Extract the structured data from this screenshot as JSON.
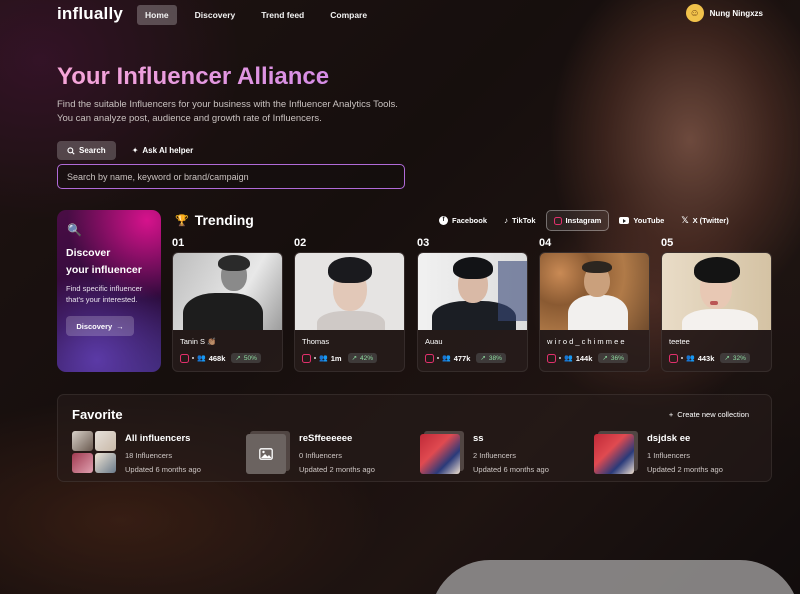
{
  "nav": {
    "logo": "influally",
    "links": [
      "Home",
      "Discovery",
      "Trend feed",
      "Compare"
    ],
    "active": "Home",
    "user_name": "Nung Ningxzs"
  },
  "hero": {
    "title": "Your Influencer Alliance",
    "description": "Find the suitable Influencers for your business with the Influencer Analytics Tools. You can analyze post, audience and growth rate of Influencers.",
    "tabs": [
      {
        "label": "Search",
        "icon": "search-icon",
        "active": true
      },
      {
        "label": "Ask AI helper",
        "icon": "sparkle-icon",
        "active": false
      }
    ],
    "search_placeholder": "Search by name, keyword or brand/campaign"
  },
  "discover": {
    "icon": "magnifier-icon",
    "title_line1": "Discover",
    "title_line2": "your influencer",
    "description": "Find specific influencer that's your interested.",
    "button_label": "Discovery",
    "button_icon": "arrow-right-icon"
  },
  "trending": {
    "title": "Trending",
    "icon": "trophy-icon",
    "platforms": [
      {
        "label": "Facebook",
        "icon": "facebook-icon",
        "active": false
      },
      {
        "label": "TikTok",
        "icon": "tiktok-icon",
        "active": false
      },
      {
        "label": "Instagram",
        "icon": "instagram-icon",
        "active": true
      },
      {
        "label": "YouTube",
        "icon": "youtube-icon",
        "active": false
      },
      {
        "label": "X (Twitter)",
        "icon": "x-icon",
        "active": false
      }
    ],
    "cards": [
      {
        "rank": "01",
        "name": "Tanin S 👏🏽",
        "followers": "468k",
        "growth": "50%"
      },
      {
        "rank": "02",
        "name": "Thomas",
        "followers": "1m",
        "growth": "42%"
      },
      {
        "rank": "03",
        "name": "Auau",
        "followers": "477k",
        "growth": "38%"
      },
      {
        "rank": "04",
        "name": "w i r o d _ c h i m m e e",
        "followers": "144k",
        "growth": "36%"
      },
      {
        "rank": "05",
        "name": "teetee",
        "followers": "443k",
        "growth": "32%"
      }
    ]
  },
  "favorite": {
    "title": "Favorite",
    "create_label": "Create new collection",
    "collections": [
      {
        "name": "All influencers",
        "count": "18 Influencers",
        "updated": "Updated 6 months ago"
      },
      {
        "name": "reSffeeeeee",
        "count": "0 Influencers",
        "updated": "Updated 2 months ago"
      },
      {
        "name": "ss",
        "count": "2 Influencers",
        "updated": "Updated 6 months ago"
      },
      {
        "name": "dsjdsk ee",
        "count": "1 Influencers",
        "updated": "Updated 2 months ago"
      }
    ]
  },
  "colors": {
    "accent_pink": "#f7a6d8",
    "search_border": "#b06ad8",
    "instagram": "#e1306c",
    "growth_green": "#8fdca0",
    "avatar_yellow": "#f1c24b"
  }
}
